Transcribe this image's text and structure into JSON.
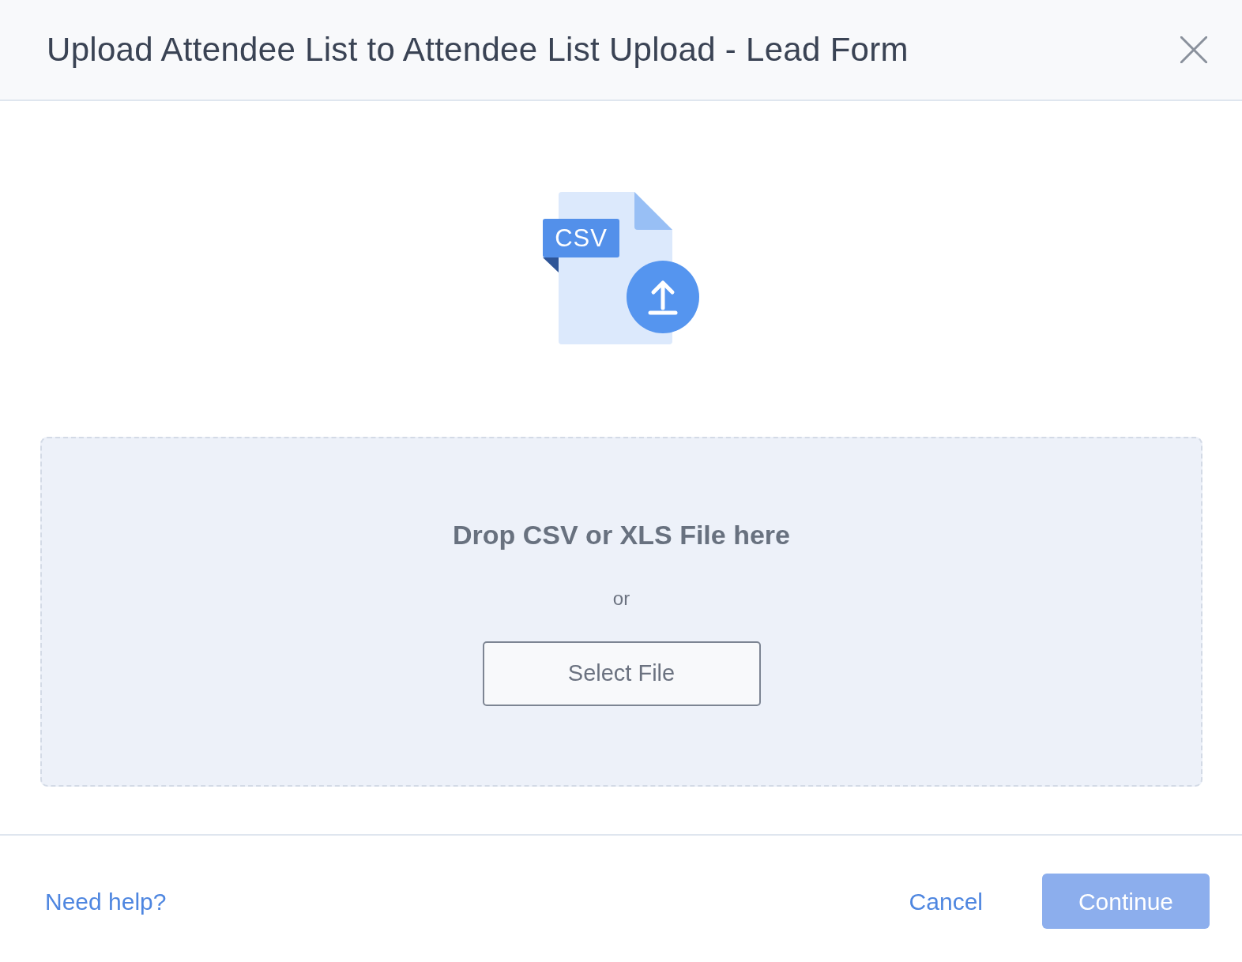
{
  "dialog": {
    "title": "Upload Attendee List to Attendee List Upload - Lead Form"
  },
  "illustration": {
    "tag": "CSV"
  },
  "dropzone": {
    "heading": "Drop CSV or XLS File here",
    "separator": "or",
    "button": "Select File"
  },
  "footer": {
    "help_link": "Need help?",
    "buttons": [
      {
        "label": "Cancel",
        "kind": "link",
        "disabled": false
      },
      {
        "label": "Continue",
        "kind": "primary",
        "disabled": true
      }
    ]
  }
}
